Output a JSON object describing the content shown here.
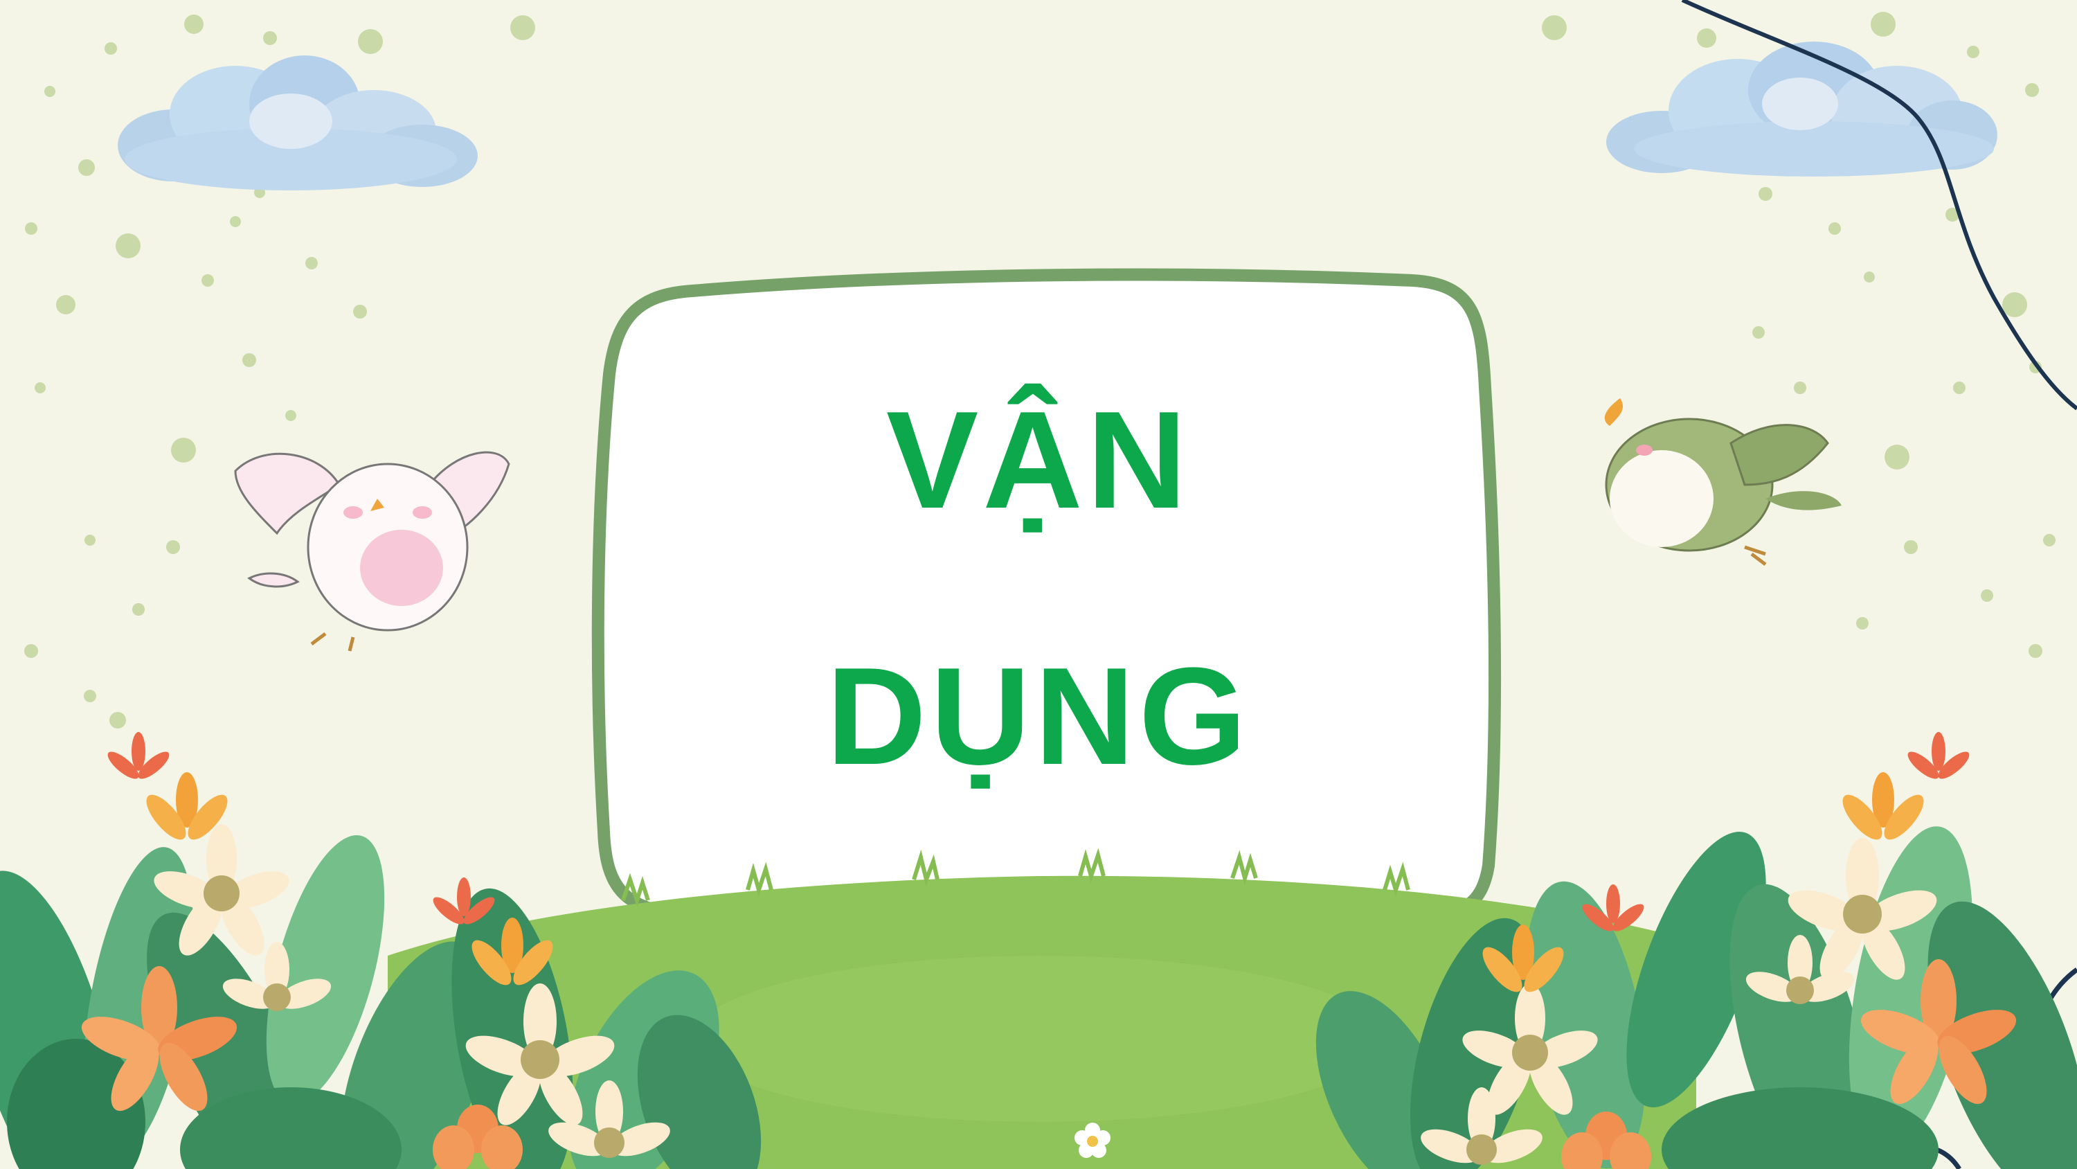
{
  "slide": {
    "title_line1": "VẬN",
    "title_line2": "DỤNG"
  },
  "colors": {
    "background": "#f4f5e6",
    "title_text": "#0da84c",
    "card_border": "#76a26a",
    "card_fill": "#ffffff",
    "grass": "#8fc45a",
    "curve_line": "#1d3450"
  },
  "decorations": {
    "left_cloud": "cloud-icon",
    "right_cloud": "cloud-icon",
    "left_bird": "pink-bird-icon",
    "right_bird": "green-bird-icon",
    "flowers": "flower-icon"
  }
}
